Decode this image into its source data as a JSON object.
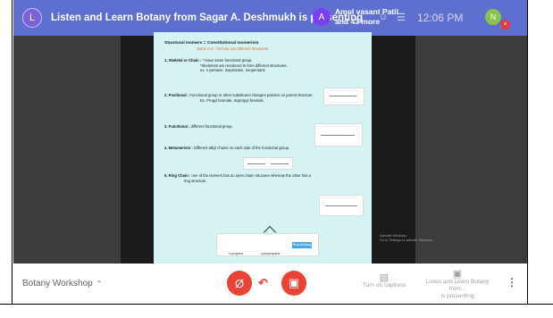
{
  "banner": {
    "presenter_initial": "L",
    "title": "Listen and Learn Botany from Sagar A. Deshmukh is presenting",
    "participant_initial": "A",
    "participant_name_line1": "Amol vasant Patil",
    "participant_name_line2": "and 43 more",
    "clock": "12:06 PM",
    "self_initial": "N"
  },
  "slide": {
    "title": "Structural Isomers = Constitutional Isomerism",
    "subtitle": "Same mol . formula and different structures",
    "items": [
      {
        "label": "1.  Skeletal or Chain :",
        "text": "* Have same functional group.",
        "note1": "*Skeletons are reordered to form different structures.",
        "note2": "ex. n-pentane, isopentane, neopentane"
      },
      {
        "label": "2. Positional :",
        "text": "Functional group or other substituent changes position on parent structure.",
        "note1": "Ex. Propyl bromide, isopropyl bromide."
      },
      {
        "label": "3. Functional :",
        "text": "different functional group."
      },
      {
        "label": "4. Metamerism :",
        "text": "Different alkyl chains on each side of the functional group."
      },
      {
        "label": "5. Ring Chain :",
        "text": "one of the isomers has an open-chain structure whereas the other has a",
        "note1": "ring structure."
      }
    ],
    "ring_chip": "Ring Marking",
    "ring_cap_left": "n-propene",
    "ring_cap_right": "cyclopropane",
    "watermark_line1": "Activate Windows",
    "watermark_line2": "Go to Settings to activate Windows."
  },
  "bottom_bar": {
    "meeting_name": "Botany Workshop",
    "captions_label": "Turn on captions",
    "presenting_label_line1": "Listen and Learn Botany from...",
    "presenting_label_line2": "is presenting"
  },
  "colors": {
    "banner": "#5f6fd0",
    "slide_bg": "#d5f3f3",
    "end_call": "#ea4335",
    "accent_text": "#e86b2e"
  }
}
